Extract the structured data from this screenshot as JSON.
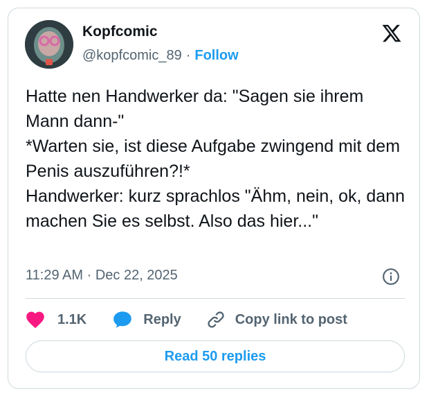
{
  "author": {
    "name": "Kopfcomic",
    "handle": "@kopfcomic_89",
    "separator": "·",
    "follow_label": "Follow",
    "avatar_icon": "profile-avatar"
  },
  "platform_icon": "x-logo-icon",
  "tweet": {
    "text": "Hatte nen Handwerker da: \"Sagen sie ihrem Mann dann-\"\n*Warten sie, ist diese Aufgabe zwingend mit dem Penis auszuführen?!*\nHandwerker: kurz sprachlos \"Ähm, nein, ok, dann machen Sie es selbst. Also das hier...\"",
    "time": "11:29 AM",
    "separator": "·",
    "date": "Dec 22, 2025"
  },
  "actions": {
    "like_count": "1.1K",
    "reply_label": "Reply",
    "copy_label": "Copy link to post"
  },
  "read_replies_label": "Read 50 replies",
  "colors": {
    "accent": "#1d9bf0",
    "like": "#f91880",
    "text": "#0f1419",
    "muted": "#536471",
    "border": "#cfd9de"
  }
}
